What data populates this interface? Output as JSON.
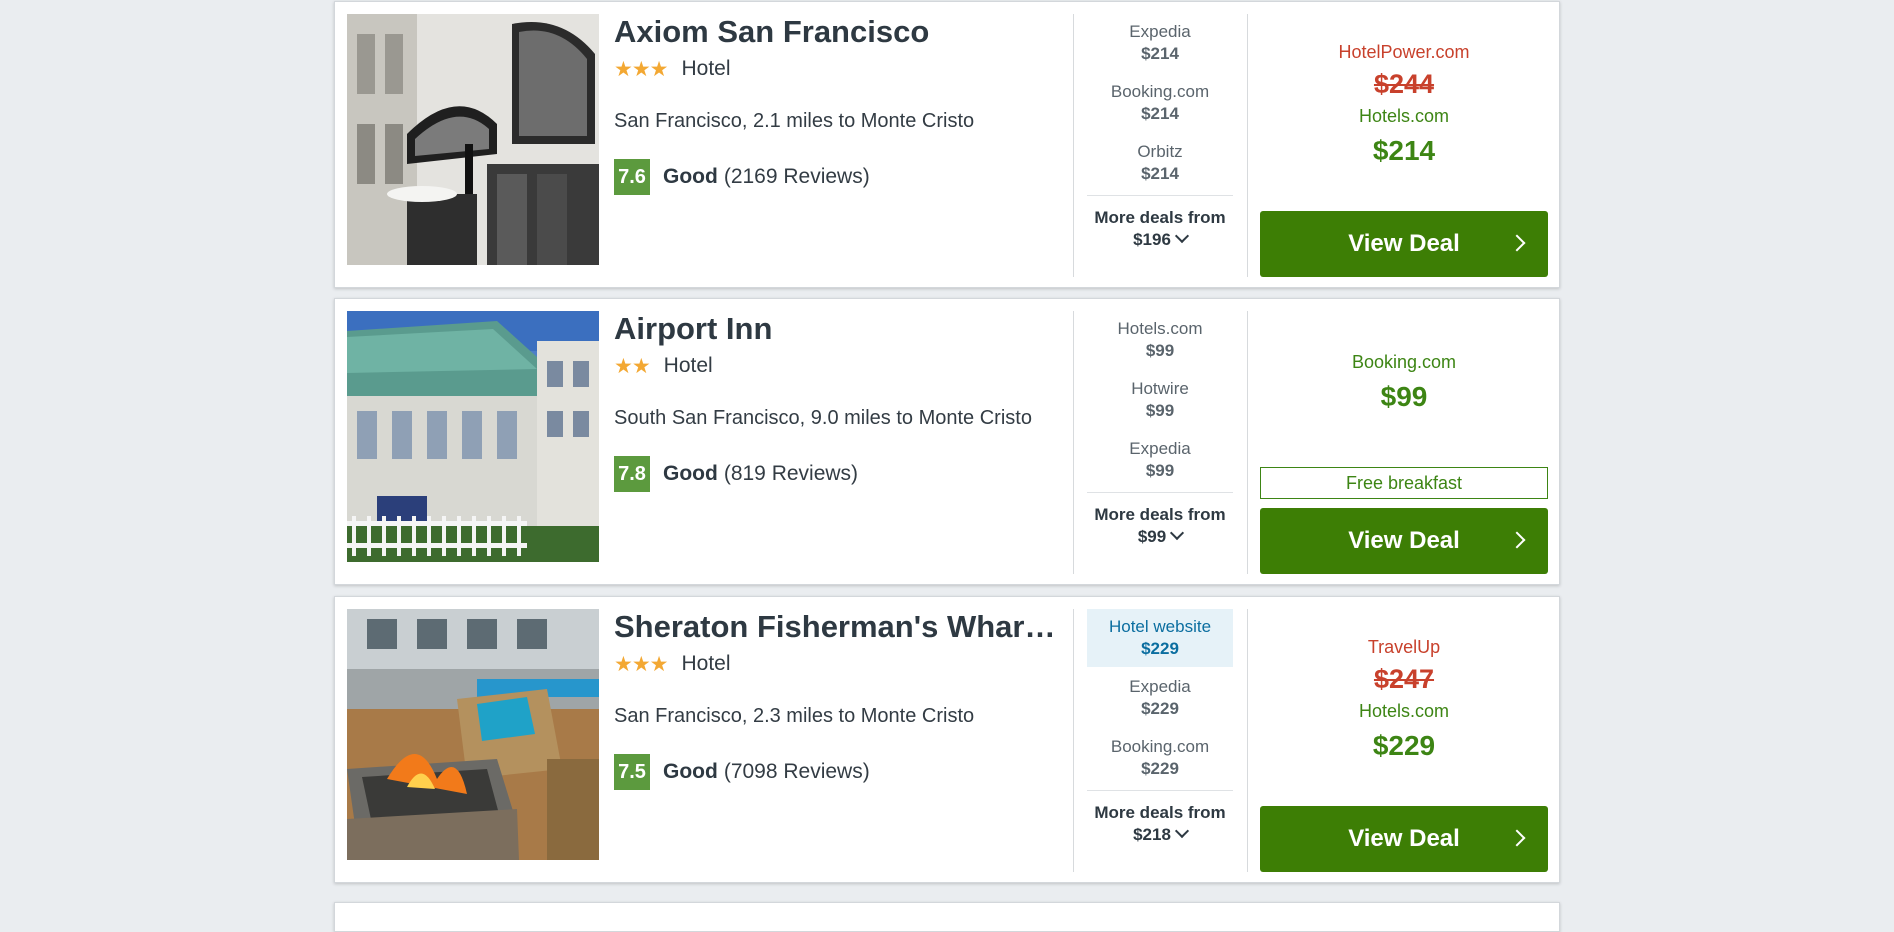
{
  "hotels": [
    {
      "name": "Axiom San Francisco",
      "stars": "★★★",
      "star_count": 3,
      "type": "Hotel",
      "location": "San Francisco, 2.1 miles to Monte Cristo",
      "score": "7.6",
      "rating_label": "Good",
      "reviews": "(2169 Reviews)",
      "providers": [
        {
          "name": "Expedia",
          "price": "$214",
          "highlight": false
        },
        {
          "name": "Booking.com",
          "price": "$214",
          "highlight": false
        },
        {
          "name": "Orbitz",
          "price": "$214",
          "highlight": false
        }
      ],
      "more_deals_label": "More deals from",
      "more_deals_price": "$196",
      "deal_top_provider": "HotelPower.com",
      "deal_strike_price": "$244",
      "deal_provider": "Hotels.com",
      "deal_price": "$214",
      "badge": "",
      "cta": "View Deal"
    },
    {
      "name": "Airport Inn",
      "stars": "★★",
      "star_count": 2,
      "type": "Hotel",
      "location": "South San Francisco, 9.0 miles to Monte Cristo",
      "score": "7.8",
      "rating_label": "Good",
      "reviews": "(819 Reviews)",
      "providers": [
        {
          "name": "Hotels.com",
          "price": "$99",
          "highlight": false
        },
        {
          "name": "Hotwire",
          "price": "$99",
          "highlight": false
        },
        {
          "name": "Expedia",
          "price": "$99",
          "highlight": false
        }
      ],
      "more_deals_label": "More deals from",
      "more_deals_price": "$99",
      "deal_top_provider": "",
      "deal_strike_price": "",
      "deal_provider": "Booking.com",
      "deal_price": "$99",
      "badge": "Free breakfast",
      "cta": "View Deal"
    },
    {
      "name": "Sheraton Fisherman's Wharf Hotel",
      "stars": "★★★",
      "star_count": 3,
      "type": "Hotel",
      "location": "San Francisco, 2.3 miles to Monte Cristo",
      "score": "7.5",
      "rating_label": "Good",
      "reviews": "(7098 Reviews)",
      "providers": [
        {
          "name": "Hotel website",
          "price": "$229",
          "highlight": true
        },
        {
          "name": "Expedia",
          "price": "$229",
          "highlight": false
        },
        {
          "name": "Booking.com",
          "price": "$229",
          "highlight": false
        }
      ],
      "more_deals_label": "More deals from",
      "more_deals_price": "$218",
      "deal_top_provider": "TravelUp",
      "deal_strike_price": "$247",
      "deal_provider": "Hotels.com",
      "deal_price": "$229",
      "badge": "",
      "cta": "View Deal"
    }
  ],
  "colors": {
    "background": "#eaedf0",
    "score_badge": "#5c9a3e",
    "cta_green": "#3d7e05",
    "deal_green": "#3d8514",
    "strike_red": "#c8412c",
    "star": "#f3a833",
    "highlight_bg": "#e6f2f8"
  },
  "icons": {
    "more_deals": "chevron-down-icon",
    "cta": "chevron-right-icon",
    "rating": "star-icon"
  }
}
